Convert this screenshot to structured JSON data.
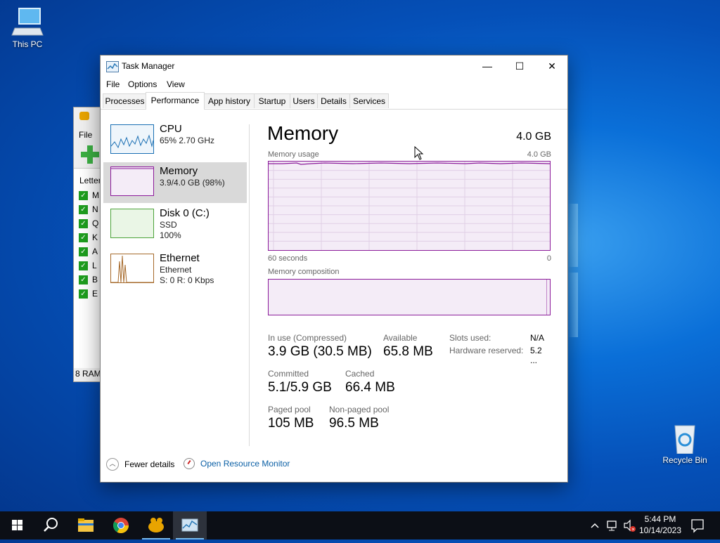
{
  "desktop": {
    "icons": [
      {
        "label": "This PC"
      },
      {
        "label": "Recycle Bin"
      }
    ]
  },
  "background_window": {
    "menu_file": "File",
    "list_header": "Letter",
    "rows": [
      "M",
      "N",
      "Q",
      "K",
      "A",
      "L",
      "B",
      "E"
    ],
    "status": "8 RAM"
  },
  "task_manager": {
    "title": "Task Manager",
    "window_controls": {
      "minimize": "—",
      "maximize": "☐",
      "close": "✕"
    },
    "menu": [
      "File",
      "Options",
      "View"
    ],
    "tabs": [
      "Processes",
      "Performance",
      "App history",
      "Startup",
      "Users",
      "Details",
      "Services"
    ],
    "active_tab": "Performance",
    "sidebar": [
      {
        "name": "CPU",
        "line1": "65%  2.70 GHz",
        "line2": "",
        "color": "#1a6fb3"
      },
      {
        "name": "Memory",
        "line1": "3.9/4.0 GB (98%)",
        "line2": "",
        "color": "#8b1a9a"
      },
      {
        "name": "Disk 0 (C:)",
        "line1": "SSD",
        "line2": "100%",
        "color": "#4da33a"
      },
      {
        "name": "Ethernet",
        "line1": "Ethernet",
        "line2": "S: 0 R: 0 Kbps",
        "color": "#a6692a"
      }
    ],
    "selected_resource": "Memory",
    "detail": {
      "title": "Memory",
      "total": "4.0 GB",
      "usage_label": "Memory usage",
      "usage_max": "4.0 GB",
      "time_left": "60 seconds",
      "time_right": "0",
      "composition_label": "Memory composition",
      "in_use_label": "In use (Compressed)",
      "in_use_value": "3.9 GB (30.5 MB)",
      "available_label": "Available",
      "available_value": "65.8 MB",
      "committed_label": "Committed",
      "committed_value": "5.1/5.9 GB",
      "cached_label": "Cached",
      "cached_value": "66.4 MB",
      "paged_label": "Paged pool",
      "paged_value": "105 MB",
      "nonpaged_label": "Non-paged pool",
      "nonpaged_value": "96.5 MB",
      "slots_label": "Slots used:",
      "slots_value": "N/A",
      "hw_label": "Hardware reserved:",
      "hw_value": "5.2 ..."
    },
    "footer": {
      "fewer_details": "Fewer details",
      "resource_monitor": "Open Resource Monitor"
    }
  },
  "taskbar": {
    "time": "5:44 PM",
    "date": "10/14/2023"
  },
  "colors": {
    "memory_accent": "#8b1a9a",
    "link": "#0a5fa5"
  }
}
